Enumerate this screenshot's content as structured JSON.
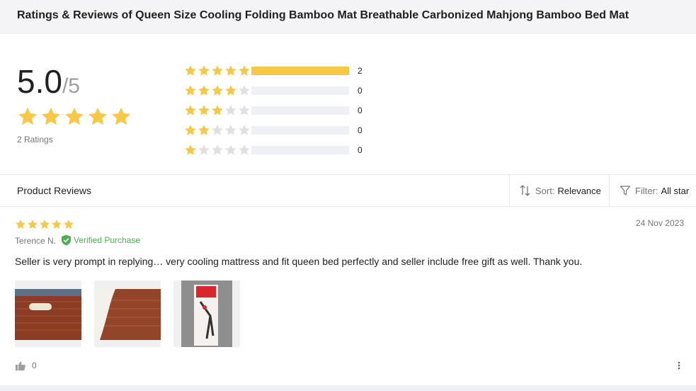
{
  "page_title": "Ratings & Reviews of Queen Size Cooling Folding Bamboo Mat Breathable Carbonized Mahjong Bamboo Bed Mat",
  "summary": {
    "average": "5.0",
    "out_of": "/5",
    "average_stars": 5,
    "ratings_count": "2 Ratings",
    "distribution": [
      {
        "stars": 5,
        "count": "2",
        "fraction": 1.0
      },
      {
        "stars": 4,
        "count": "0",
        "fraction": 0
      },
      {
        "stars": 3,
        "count": "0",
        "fraction": 0
      },
      {
        "stars": 2,
        "count": "0",
        "fraction": 0
      },
      {
        "stars": 1,
        "count": "0",
        "fraction": 0
      }
    ]
  },
  "reviews_section": {
    "title": "Product Reviews",
    "sort_label": "Sort:",
    "sort_value": "Relevance",
    "filter_label": "Filter:",
    "filter_value": "All star"
  },
  "review": {
    "stars": 5,
    "date": "24 Nov 2023",
    "author": "Terence N.",
    "verified_label": "Verified Purchase",
    "text": "Seller is very prompt in replying… very cooling mattress and fit queen bed perfectly and seller include free gift as well. Thank you.",
    "likes": "0",
    "photos": [
      "bamboo-mat-photo",
      "bamboo-mat-corner-photo",
      "free-gift-tool-photo"
    ]
  },
  "colors": {
    "star_filled": "#f7c845",
    "star_empty": "#e0e0e0",
    "verified_green": "#4caf50",
    "bar_track": "#eff0f5"
  }
}
